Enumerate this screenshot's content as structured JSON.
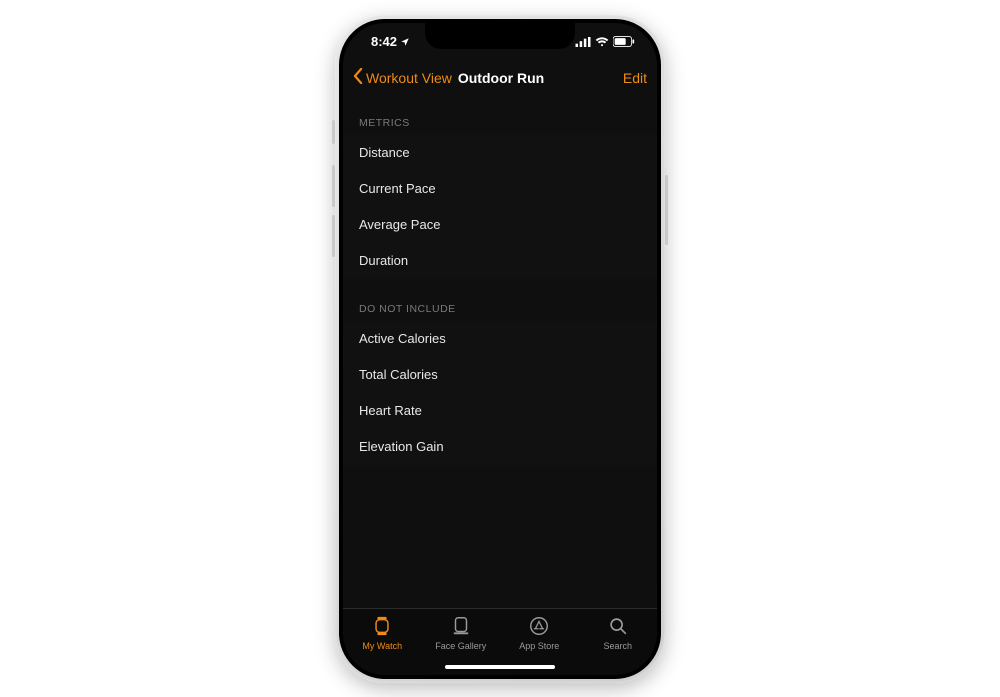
{
  "status": {
    "time": "8:42"
  },
  "nav": {
    "back_label": "Workout View",
    "title": "Outdoor Run",
    "edit": "Edit"
  },
  "sections": {
    "metrics_header": "METRICS",
    "metrics": [
      "Distance",
      "Current Pace",
      "Average Pace",
      "Duration"
    ],
    "exclude_header": "DO NOT INCLUDE",
    "exclude": [
      "Active Calories",
      "Total Calories",
      "Heart Rate",
      "Elevation Gain"
    ]
  },
  "tabs": {
    "watch": "My Watch",
    "gallery": "Face Gallery",
    "appstore": "App Store",
    "search": "Search"
  },
  "colors": {
    "accent": "#ed8b17"
  }
}
